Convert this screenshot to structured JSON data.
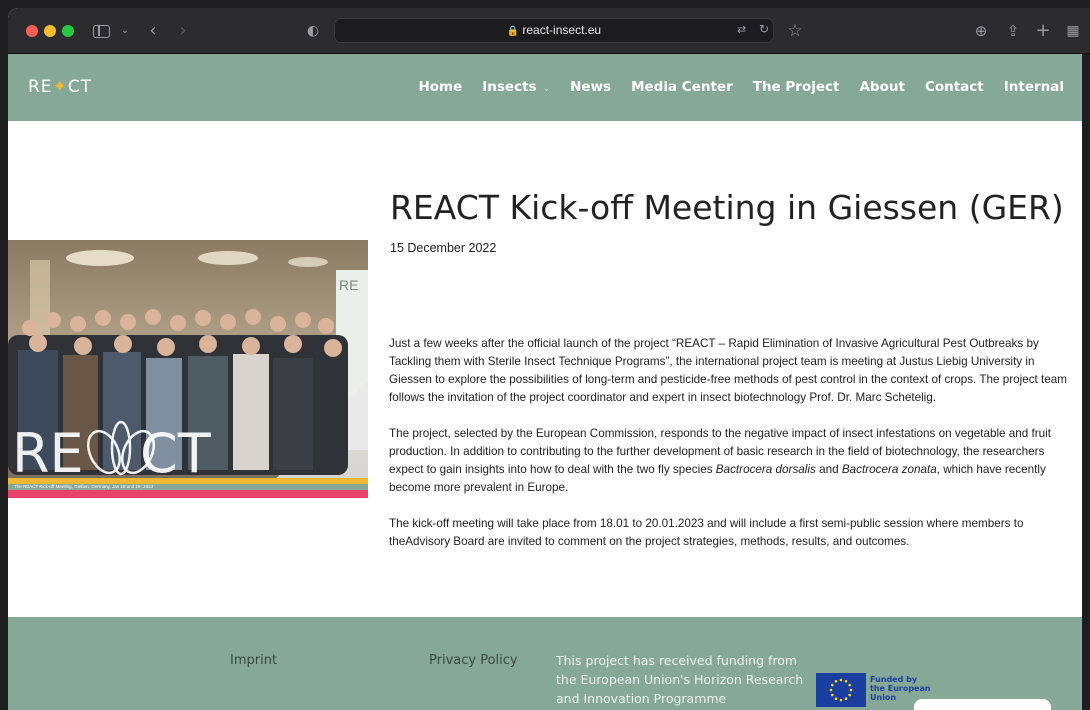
{
  "browser": {
    "url": "react-insect.eu"
  },
  "site": {
    "logo": {
      "pre": "RE",
      "post": "CT"
    },
    "nav": [
      {
        "label": "Home"
      },
      {
        "label": "Insects",
        "has_dropdown": true
      },
      {
        "label": "News"
      },
      {
        "label": "Media Center"
      },
      {
        "label": "The Project"
      },
      {
        "label": "About"
      },
      {
        "label": "Contact"
      },
      {
        "label": "Internal"
      }
    ]
  },
  "article": {
    "title": "REACT Kick-off Meeting in Giessen (GER)",
    "date": "15 December 2022",
    "image_caption": "The REACT Kick-off Meeting, Gießen, Germany, Jan 18 and 19, 2023",
    "paragraphs": [
      {
        "text": "Just a few weeks after the official launch of the project “REACT – Rapid Elimination of Invasive Agricultural Pest Outbreaks by Tackling them with Sterile Insect Technique Programs”, the international project team is meeting at Justus Liebig University in Giessen to explore the possibilities of long-term and pesticide-free methods of pest control in the context of crops. The project team follows the invitation of the project coordinator and expert in insect biotechnology Prof. Dr. Marc Schetelig."
      },
      {
        "part1": "The project, selected by the European Commission, responds to the negative impact of insect infestations on vegetable and fruit production. In addition to contributing to the further development of basic research in the field of biotechnology, the researchers expect to gain insights into how to deal with the two fly species ",
        "species1": "Bactrocera dorsalis",
        "part2": " and ",
        "species2": "Bactrocera zonata",
        "part3": ", which have recently become more prevalent in Europe."
      },
      {
        "text": "The kick-off meeting will take place from 18.01 to 20.01.2023 and will include a first semi-public session where members to theAdvisory Board are invited to comment on the project strategies, methods, results, and outcomes."
      }
    ]
  },
  "footer": {
    "imprint": "Imprint",
    "privacy": "Privacy Policy",
    "funding": "This project has received funding from the European Union's Horizon Research and Innovation Programme",
    "eu_label": [
      "Funded by",
      "the European",
      "Union"
    ]
  },
  "colors": {
    "header_bg": "#86a896",
    "accent_yellow": "#f2b733",
    "accent_pink": "#e8426b",
    "eu_blue": "#1a3fa0"
  }
}
